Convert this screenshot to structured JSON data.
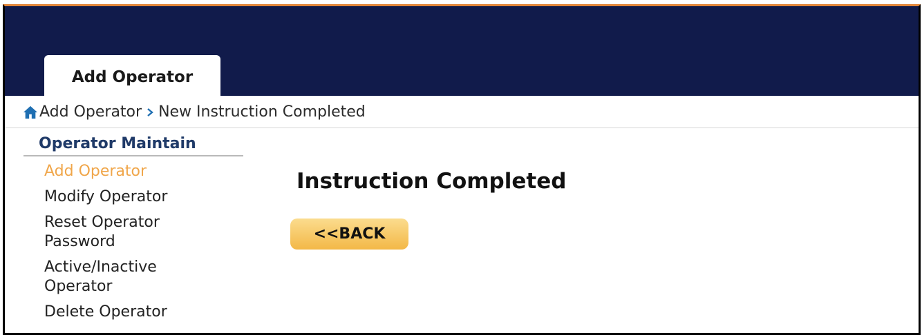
{
  "header": {
    "active_tab": "Add Operator",
    "background_color": "#111b4b",
    "top_border_color": "#e2873a"
  },
  "breadcrumb": {
    "home_icon": "home-icon",
    "items": [
      "Add Operator",
      "New Instruction Completed"
    ],
    "separator_icon": "chevron-right-icon"
  },
  "sidebar": {
    "title": "Operator Maintain",
    "items": [
      {
        "label": "Add Operator",
        "active": true
      },
      {
        "label": "Modify Operator",
        "active": false
      },
      {
        "label": "Reset Operator Password",
        "active": false
      },
      {
        "label": "Active/Inactive Operator",
        "active": false
      },
      {
        "label": "Delete Operator",
        "active": false
      }
    ],
    "active_color": "#f0a64a"
  },
  "main": {
    "heading": "Instruction Completed",
    "back_button_label": "<<BACK",
    "button_color": "#f3b847"
  }
}
